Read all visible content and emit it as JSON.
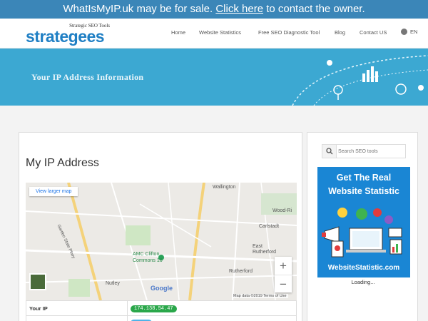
{
  "notice": {
    "prefix": "WhatIsMyIP.uk may be for sale. ",
    "link": "Click here",
    "suffix": " to contact the owner."
  },
  "brand": {
    "tagline": "Strategic SEO Tools",
    "name": "strategees"
  },
  "nav": {
    "items": [
      "Home",
      "Website Statistics",
      "Free SEO Diagnostic Tool",
      "Blog",
      "Contact US"
    ],
    "language": "EN"
  },
  "banner": {
    "title": "Your IP Address Information"
  },
  "main": {
    "title": "My IP Address",
    "map": {
      "view_larger": "View larger map",
      "zoom_in": "+",
      "zoom_out": "−",
      "google": "Google",
      "footer": "Map data ©2019   Terms of Use",
      "poi": "AMC Clifton\nCommons 16",
      "places": [
        "Wallington",
        "Wood-Ri",
        "Carlstadt",
        "East Rutherford",
        "Rutherford",
        "Nutley",
        "Garden State Pkwy"
      ]
    },
    "table": [
      {
        "label": "Your IP",
        "value": "174.138.54.47"
      }
    ]
  },
  "sidebar": {
    "search_placeholder": "Search SEO tools",
    "ad": {
      "line1": "Get The Real",
      "line2": "Website Statistic",
      "footer": "WebsiteStatistic.com"
    },
    "loading": "Loading..."
  },
  "colors": {
    "topbar": "#3b86b8",
    "banner": "#3ca8d2",
    "brand": "#1f7fc4",
    "ip_badge": "#2aa74a",
    "ad_bg": "#1a86d4"
  }
}
